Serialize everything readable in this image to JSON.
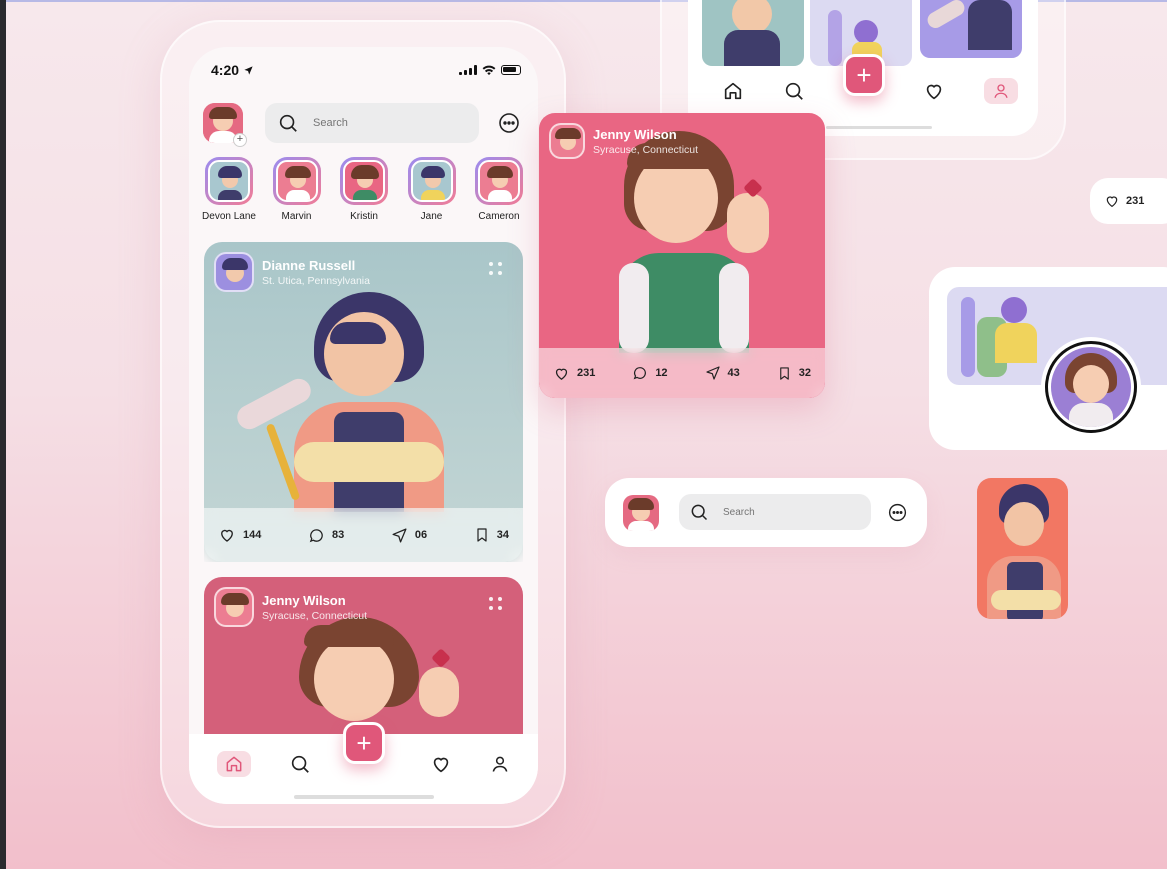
{
  "status_bar": {
    "time": "4:20"
  },
  "search": {
    "placeholder": "Search"
  },
  "stories": [
    {
      "name": "Devon Lane"
    },
    {
      "name": "Marvin"
    },
    {
      "name": "Kristin"
    },
    {
      "name": "Jane"
    },
    {
      "name": "Cameron"
    }
  ],
  "posts": [
    {
      "author": "Dianne Russell",
      "location": "St. Utica, Pennsylvania",
      "likes": "144",
      "comments": "83",
      "shares": "06",
      "saves": "34"
    },
    {
      "author": "Jenny Wilson",
      "location": "Syracuse, Connecticut"
    }
  ],
  "featured_post": {
    "author": "Jenny Wilson",
    "location": "Syracuse, Connecticut",
    "likes": "231",
    "comments": "12",
    "shares": "43",
    "saves": "32"
  },
  "like_pill": {
    "count": "231"
  },
  "fab": {
    "label": "+"
  },
  "colors": {
    "accent": "#e0577a",
    "post_blue": "#a9c6c9",
    "post_pink": "#e96683",
    "tile_coral": "#f27763",
    "story_ring_start": "#9a8cf0",
    "story_ring_end": "#f27c95"
  },
  "icons": [
    "home-icon",
    "search-icon",
    "plus-icon",
    "heart-icon",
    "profile-icon",
    "chat-icon",
    "comment-icon",
    "send-icon",
    "bookmark-icon",
    "location-arrow-icon"
  ]
}
